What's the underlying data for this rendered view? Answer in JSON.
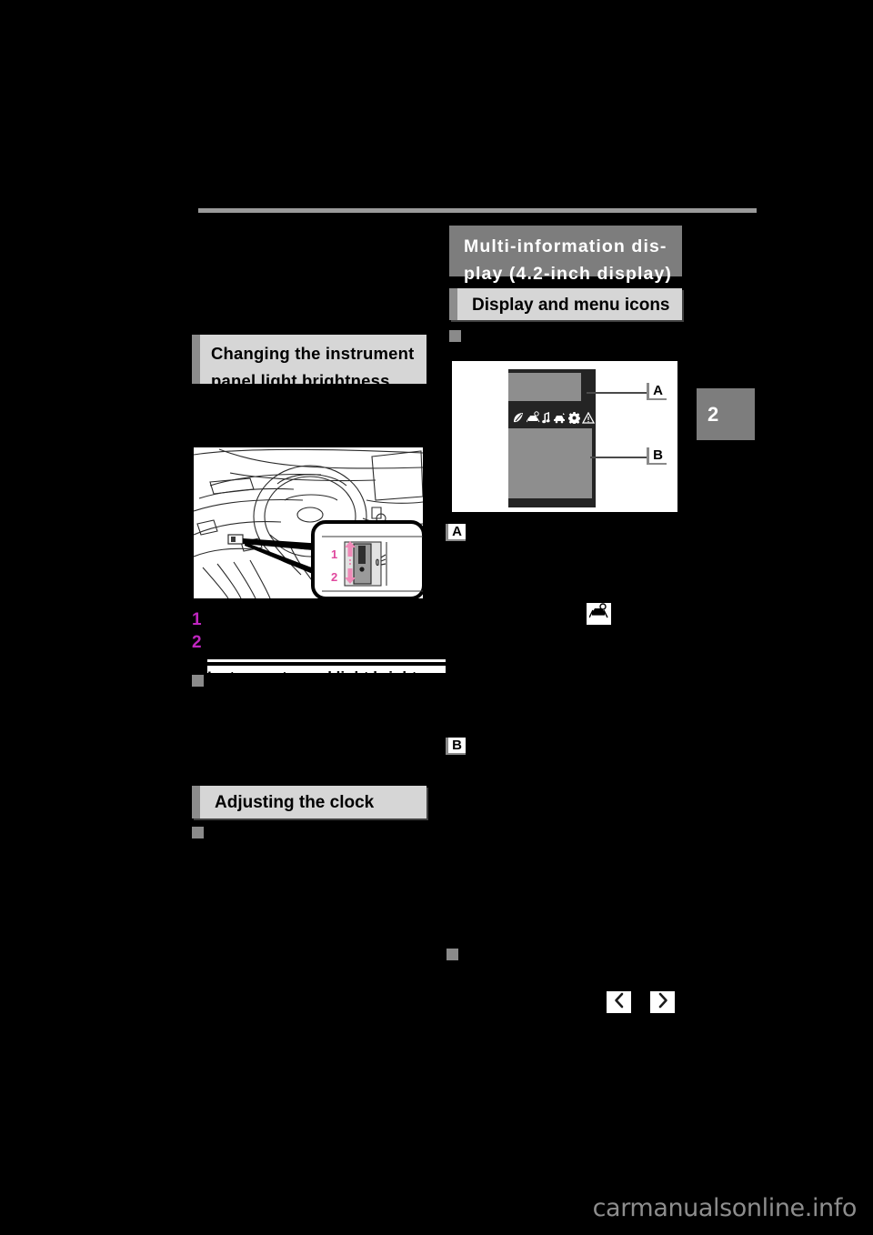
{
  "page": {
    "background_color": "#000000",
    "chapter_number": "2",
    "watermark": "carmanualsonline.info"
  },
  "left_column": {
    "heading_instrument_brightness": "Changing the instrument panel light brightness",
    "steps": [
      {
        "number": "1",
        "text": ""
      },
      {
        "number": "2",
        "text": ""
      }
    ],
    "subheading_instrument_light": "Instrument panel light bright-",
    "heading_adjusting_clock": "Adjusting the clock",
    "bullet_after_clock": "square-bullet",
    "illustration": {
      "name": "dashboard-dimmer-switch",
      "callout_labels": [
        "1",
        "2"
      ],
      "callout_label_color": "#e0489e"
    }
  },
  "right_column": {
    "heading_multi_info_display": "Multi-information dis-play (4.2-inch display)",
    "heading_display_menu_icons": "Display and menu icons",
    "bullet_before_illustration": "square-bullet",
    "illustration": {
      "name": "multi-information-display",
      "markers": [
        "A",
        "B"
      ],
      "menu_icons": [
        "eco-leaf-icon",
        "vehicle-front-sensor-icon",
        "music-note-icon",
        "vehicle-side-icon",
        "gear-icon",
        "warning-triangle-icon"
      ]
    },
    "marker_a": "A",
    "marker_b": "B",
    "inline_icon_vehicle_sensor": "vehicle-front-sensor-icon",
    "bullet_before_arrows": "square-bullet",
    "nav_arrows": {
      "previous": "chevron-left-icon",
      "next": "chevron-right-icon"
    }
  },
  "colors": {
    "major_heading_bg": "#7d7d7d",
    "minor_heading_bg": "#d6d6d6",
    "minor_heading_bar": "#8c8c8c",
    "bullet": "#8a8a8a",
    "number_marker": "#c026c0",
    "rule": "#9a9a9a",
    "watermark": "#8d8d8d"
  }
}
